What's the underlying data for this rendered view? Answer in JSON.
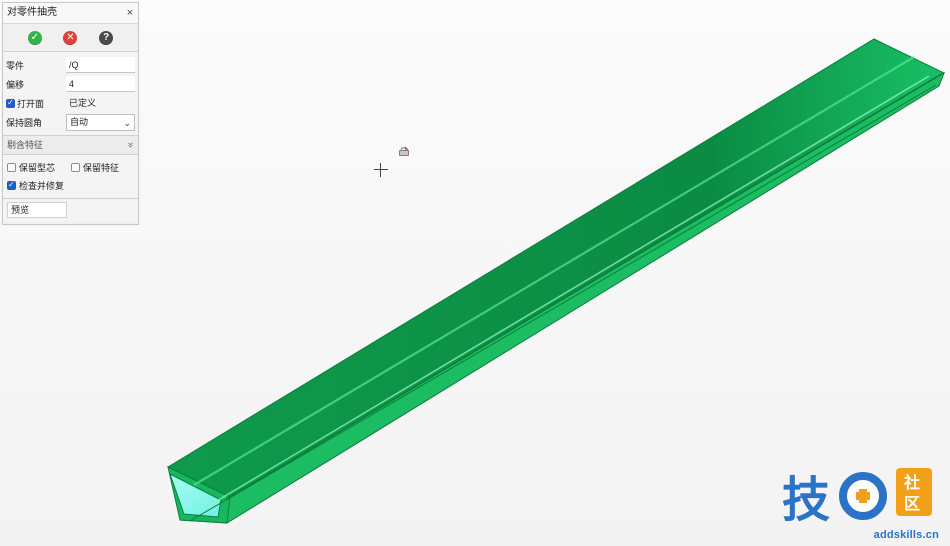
{
  "panel": {
    "title": "对零件抽壳",
    "close_label": "×",
    "actions": {
      "ok_label": "✓",
      "cancel_label": "✕",
      "help_label": "?"
    },
    "fields": {
      "part_label": "零件",
      "part_value": "/Q",
      "offset_label": "偏移",
      "offset_value": "4",
      "open_face_label": "打开面",
      "open_face_value": "已定义",
      "keep_fillet_label": "保持圆角",
      "keep_fillet_value": "自动"
    },
    "collapsed_section_label": "剔含特征",
    "options": {
      "keep_core_label": "保留型芯",
      "keep_feature_label": "保留特征",
      "check_fix_label": "检查并修复"
    },
    "preview_label": "预览",
    "states": {
      "open_face_checked": true,
      "keep_core_checked": false,
      "keep_feature_checked": false,
      "check_fix_checked": true
    }
  },
  "viewport": {
    "part_colors": {
      "main": "#11b85b",
      "shade": "#0b8f44",
      "light": "#53e08b",
      "edge": "#0c7d3d"
    },
    "cursor": {
      "crosshair_icon": "crosshair-icon",
      "tooltip_icon": "selection-filter-icon"
    }
  },
  "watermark": {
    "main_text": "技",
    "plus_text": "+",
    "side_text_1": "社",
    "side_text_2": "区",
    "domain_text": "addskills.cn"
  }
}
